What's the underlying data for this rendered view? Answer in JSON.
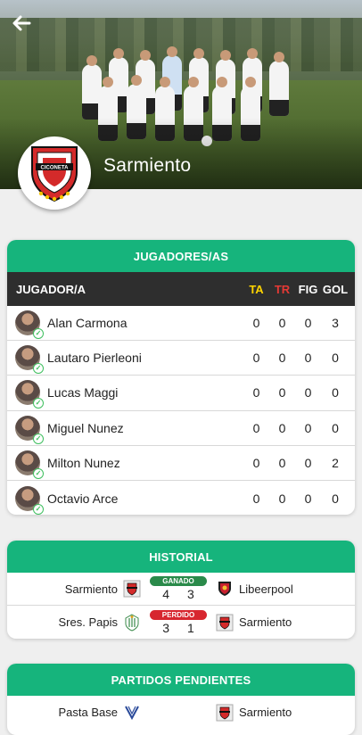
{
  "header": {
    "club_name": "Sarmiento",
    "back_icon": "arrow-left-icon"
  },
  "players_card": {
    "title": "JUGADORES/AS",
    "columns": [
      "JUGADOR/A",
      "TA",
      "TR",
      "FIG",
      "GOL"
    ],
    "rows": [
      {
        "name": "Alan Carmona",
        "ta": "0",
        "tr": "0",
        "fig": "0",
        "gol": "3"
      },
      {
        "name": "Lautaro Pierleoni",
        "ta": "0",
        "tr": "0",
        "fig": "0",
        "gol": "0"
      },
      {
        "name": "Lucas Maggi",
        "ta": "0",
        "tr": "0",
        "fig": "0",
        "gol": "0"
      },
      {
        "name": "Miguel Nunez",
        "ta": "0",
        "tr": "0",
        "fig": "0",
        "gol": "0"
      },
      {
        "name": "Milton Nunez",
        "ta": "0",
        "tr": "0",
        "fig": "0",
        "gol": "2"
      },
      {
        "name": "Octavio Arce",
        "ta": "0",
        "tr": "0",
        "fig": "0",
        "gol": "0"
      }
    ]
  },
  "history_card": {
    "title": "HISTORIAL",
    "matches": [
      {
        "home": "Sarmiento",
        "away": "Libeerpool",
        "result": "GANADO",
        "home_score": "4",
        "away_score": "3"
      },
      {
        "home": "Sres. Papis",
        "away": "Sarmiento",
        "result": "PERDIDO",
        "home_score": "3",
        "away_score": "1"
      }
    ]
  },
  "pending_card": {
    "title": "PARTIDOS PENDIENTES",
    "matches": [
      {
        "home": "Pasta Base",
        "away": "Sarmiento"
      }
    ]
  },
  "colors": {
    "accent": "#16b47c",
    "table_header": "#2e2e2e",
    "won": "#2a8a4a",
    "lost": "#d7262f",
    "ta": "#ffd400",
    "tr": "#e53935"
  }
}
